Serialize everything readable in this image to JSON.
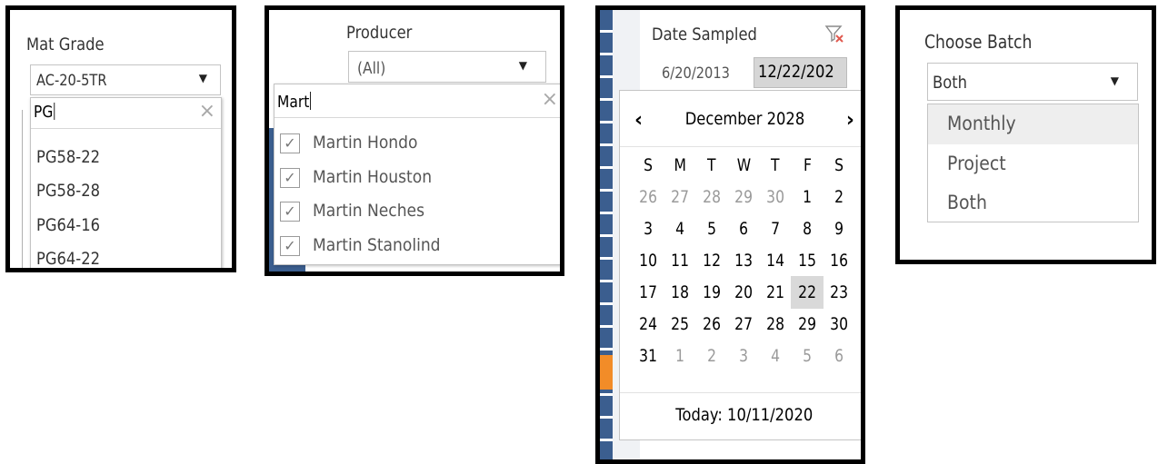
{
  "mat_grade": {
    "title": "Mat Grade",
    "selected": "AC-20-5TR",
    "search_text": "PG",
    "clear_icon": "×",
    "options": [
      "PG58-22",
      "PG58-28",
      "PG64-16",
      "PG64-22"
    ]
  },
  "producer": {
    "title": "Producer",
    "selected": "(All)",
    "search_text": "Mart",
    "clear_icon": "×",
    "items": [
      {
        "label": "Martin Hondo",
        "checked": true
      },
      {
        "label": "Martin Houston",
        "checked": true
      },
      {
        "label": "Martin Neches",
        "checked": true
      },
      {
        "label": "Martin Stanolind",
        "checked": true
      }
    ]
  },
  "date_sampled": {
    "title": "Date Sampled",
    "start_date": "6/20/2013",
    "end_date": "12/22/202",
    "month_label": "December 2028",
    "prev_icon": "‹",
    "next_icon": "›",
    "weekdays": [
      "S",
      "M",
      "T",
      "W",
      "T",
      "F",
      "S"
    ],
    "weeks": [
      [
        "26",
        "27",
        "28",
        "29",
        "30",
        "1",
        "2"
      ],
      [
        "3",
        "4",
        "5",
        "6",
        "7",
        "8",
        "9"
      ],
      [
        "10",
        "11",
        "12",
        "13",
        "14",
        "15",
        "16"
      ],
      [
        "17",
        "18",
        "19",
        "20",
        "21",
        "22",
        "23"
      ],
      [
        "24",
        "25",
        "26",
        "27",
        "28",
        "29",
        "30"
      ],
      [
        "31",
        "1",
        "2",
        "3",
        "4",
        "5",
        "6"
      ]
    ],
    "other_month_cells": [
      [
        0,
        0
      ],
      [
        0,
        1
      ],
      [
        0,
        2
      ],
      [
        0,
        3
      ],
      [
        0,
        4
      ],
      [
        5,
        1
      ],
      [
        5,
        2
      ],
      [
        5,
        3
      ],
      [
        5,
        4
      ],
      [
        5,
        5
      ],
      [
        5,
        6
      ]
    ],
    "selected_cell": [
      3,
      5
    ],
    "today_label": "Today: 10/11/2020",
    "colors": {
      "accent_bar": "#3b5e8f",
      "orange_marker": "#f28c28",
      "filter_x": "#e05a4f"
    }
  },
  "choose_batch": {
    "title": "Choose Batch",
    "selected": "Both",
    "options": [
      "Monthly",
      "Project",
      "Both"
    ],
    "highlighted_index": 0
  }
}
